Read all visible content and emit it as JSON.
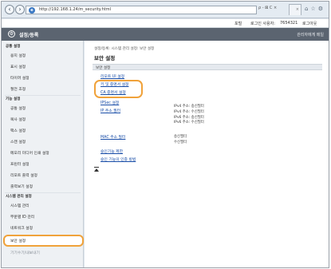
{
  "browser": {
    "url": "http://192.168.1.24/m_security.html",
    "address_tools": "ρ - ⊠ C ×",
    "back_icon": "back-arrow-icon",
    "forward_icon": "forward-arrow-icon"
  },
  "topbar": {
    "portal": "포털",
    "login_user_label": "로그인 사용자:",
    "login_user": "7654321",
    "logout": "로그아웃"
  },
  "header": {
    "title": "설정/등록",
    "admin_mail": "관리자에게 메일"
  },
  "sidebar": {
    "sections": [
      {
        "label": "공통 설정",
        "items": [
          "용지 설정",
          "표시 설정",
          "타이머 설정",
          "절전 조정"
        ]
      },
      {
        "label": "기능 설정",
        "items": [
          "공통 설정",
          "복사 설정",
          "팩스 설정",
          "스캔 설정",
          "메모리 미디어 인쇄 설정",
          "프린터 설정",
          "리포트 출력 설정",
          "출력보기 설정"
        ]
      },
      {
        "label": "시스템 관리 설정",
        "items": [
          "시스템 관리",
          "부문별 ID 관리",
          "네트워크 설정",
          "보안 설정",
          "기기수기/내보내기"
        ]
      }
    ]
  },
  "content": {
    "breadcrumb": "설정/등록: 시스템 관리 설정: 보안 설정",
    "title": "보안 설정",
    "section_label": "보안 설정",
    "links": {
      "remote_ui": "리모트 UI 설정",
      "key_cert": "키 및 증명서 설정",
      "ca_cert": "CA 증명서 설정",
      "ipsec": "IPSec 설정",
      "ip_filter": "IP 주소 필터",
      "mac_filter": "MAC 주소 필터",
      "auth_limit": "승인기능 제한",
      "auth_method": "승인 기능의 인증 방법"
    },
    "ip_filter_info": [
      "IPv4 주소: 송신필터",
      "IPv4 주소: 수신필터",
      "IPv6 주소: 송신필터",
      "IPv6 주소: 수신필터"
    ],
    "mac_filter_info": [
      "송신필터",
      "수신필터"
    ]
  }
}
